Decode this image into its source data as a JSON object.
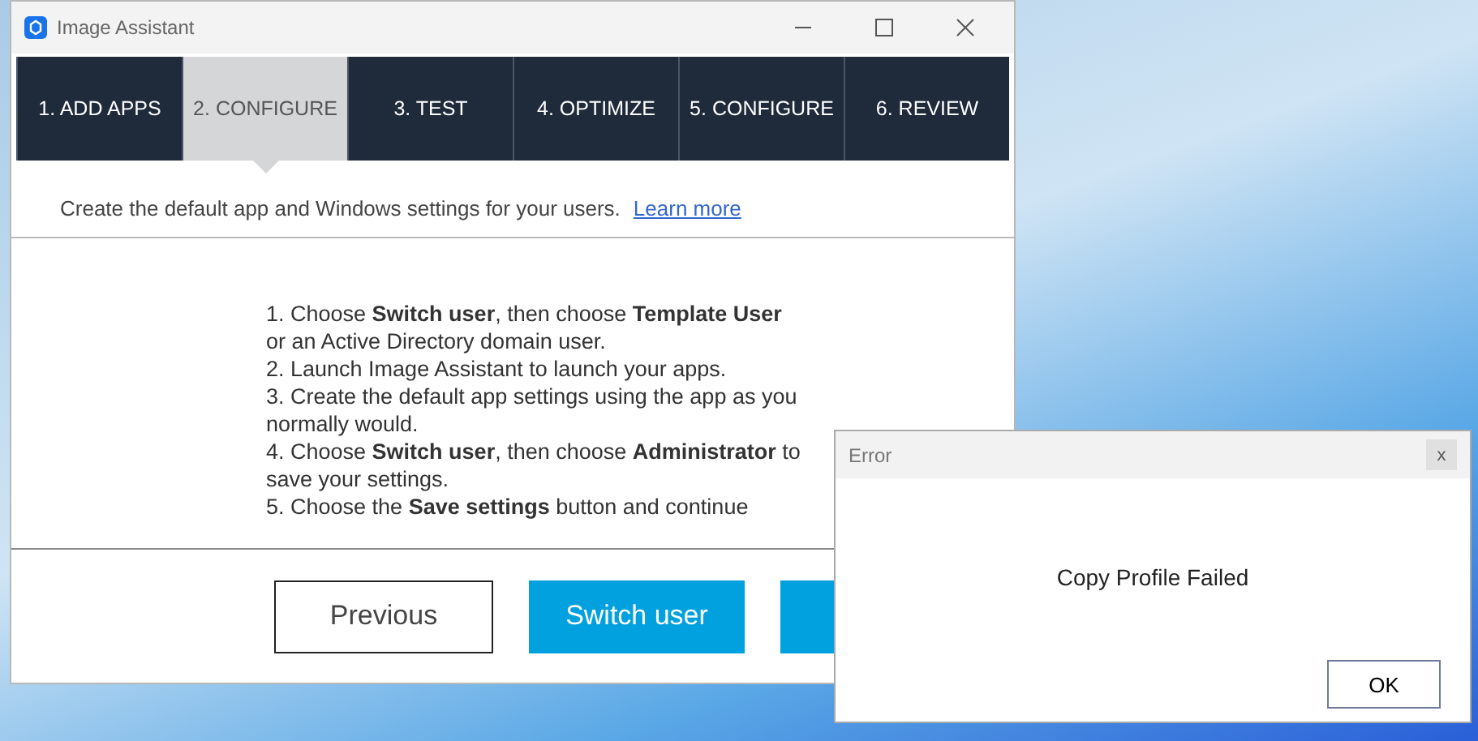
{
  "window": {
    "title": "Image Assistant"
  },
  "tabs": [
    {
      "label": "1. ADD APPS",
      "selected": false
    },
    {
      "label": "2. CONFIGURE",
      "selected": true
    },
    {
      "label": "3. TEST",
      "selected": false
    },
    {
      "label": "4. OPTIMIZE",
      "selected": false
    },
    {
      "label": "5. CONFIGURE",
      "selected": false
    },
    {
      "label": "6. REVIEW",
      "selected": false
    }
  ],
  "description": {
    "text": "Create the default app and Windows settings for your users.",
    "link": "Learn more"
  },
  "steps": [
    "1. Choose **Switch user**, then choose **Template User** or an Active Directory domain user.",
    "2. Launch Image Assistant to launch your apps.",
    "3. Create the default app settings using the app as you normally would.",
    "4. Choose **Switch user**, then choose **Administrator** to save your settings.",
    "5. Choose the **Save settings** button and continue"
  ],
  "buttons": [
    {
      "label": "Previous",
      "kind": "outline"
    },
    {
      "label": "Switch user",
      "kind": "primary"
    },
    {
      "kind": "primary"
    }
  ],
  "dialog": {
    "title": "Error",
    "close": "x",
    "message": "Copy Profile Failed",
    "button": "OK"
  }
}
